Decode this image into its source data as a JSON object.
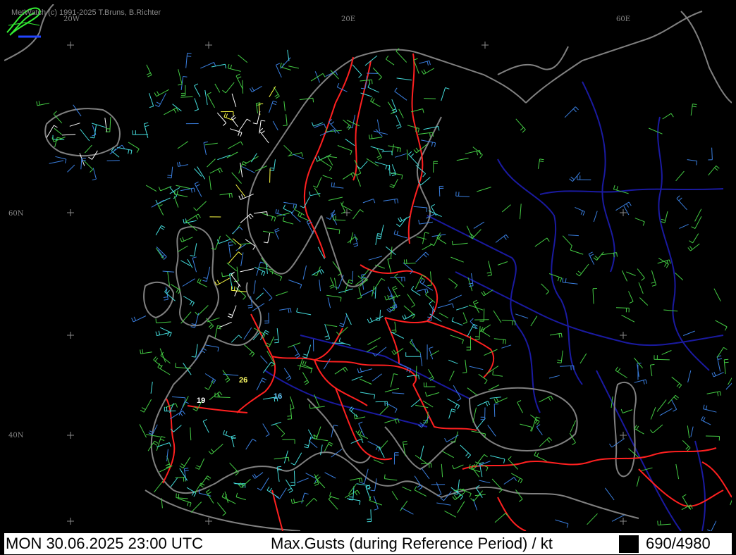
{
  "app": {
    "copyright": "MetWatch  (c) 1991-2025 T.Bruns, B.Richter"
  },
  "grid_labels": {
    "lon_20w": "20W",
    "lon_20e": "20E",
    "lon_60e": "60E",
    "lat_60n": "60N",
    "lat_40n": "40N"
  },
  "station_values": [
    {
      "value": "26",
      "color": "#ffff66"
    },
    {
      "value": "19",
      "color": "#ffffff"
    },
    {
      "value": "16",
      "color": "#66ccff"
    }
  ],
  "status": {
    "datetime": "MON 30.06.2025 23:00 UTC",
    "parameter": "Max.Gusts (during Reference Period) / kt",
    "count": "690/4980"
  },
  "colors": {
    "background": "#000000",
    "coastline": "#808080",
    "country_border": "#ff2020",
    "rivers": "#1a1aa0",
    "barb_green": "#44cc44",
    "barb_blue": "#3a7fe0",
    "barb_cyan": "#44dddd",
    "barb_white": "#ffffff",
    "barb_yellow": "#ffff44"
  }
}
